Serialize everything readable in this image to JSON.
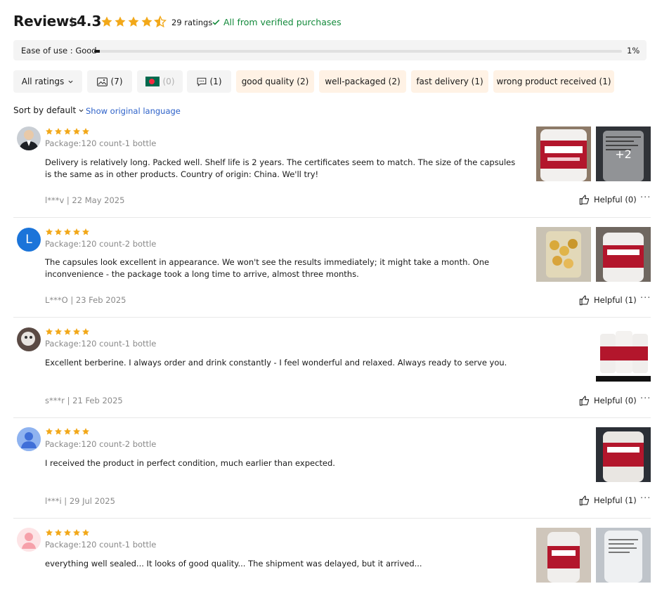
{
  "header": {
    "title": "Reviews",
    "separator": "|",
    "score": "4.3",
    "rating": 4.3,
    "ratings_count": "29 ratings",
    "verified": "All from verified purchases"
  },
  "ease": {
    "label": "Ease of use : Good",
    "percent": "1%",
    "fraction": 0.01
  },
  "filters": {
    "all_ratings": "All ratings",
    "photos": "(7)",
    "country": "(0)",
    "comments": "(1)",
    "tags": [
      "good quality (2)",
      "well-packaged (2)",
      "fast delivery (1)",
      "wrong product received (1)"
    ]
  },
  "sort": {
    "label": "Sort by default",
    "original_language": "Show original language"
  },
  "reviews": [
    {
      "package": "Package:120 count-1 bottle",
      "text": "Delivery is relatively long. Packed well. Shelf life is 2 years. The certificates seem to match. The size of the capsules is the same as in other products. Country of origin: China. We'll try!",
      "meta": "l***v | 22 May 2025",
      "helpful": "Helpful (0)",
      "more_photos": "+2",
      "stars": 5
    },
    {
      "package": "Package:120 count-2 bottle",
      "text": "The capsules look excellent in appearance. We won't see the results immediately; it might take a month. One inconvenience - the package took a long time to arrive, almost three months.",
      "meta": "L***O | 23 Feb 2025",
      "helpful": "Helpful (1)",
      "avatar_letter": "L",
      "stars": 5
    },
    {
      "package": "Package:120 count-1 bottle",
      "text": "Excellent berberine. I always order and drink constantly - I feel wonderful and relaxed. Always ready to serve you.",
      "meta": "s***r | 21 Feb 2025",
      "helpful": "Helpful (0)",
      "stars": 5
    },
    {
      "package": "Package:120 count-2 bottle",
      "text": "I received the product in perfect condition, much earlier than expected.",
      "meta": "l***i | 29 Jul 2025",
      "helpful": "Helpful (1)",
      "stars": 5
    },
    {
      "package": "Package:120 count-1 bottle",
      "text": "everything well sealed... It looks of good quality... The shipment was delayed, but it arrived...",
      "stars": 5
    }
  ],
  "colors": {
    "star": "#f2a819",
    "verified": "#138a3b",
    "link": "#2e62c9",
    "chip_grey": "#f4f4f4",
    "chip_peach": "#fff2e5"
  },
  "icons": [
    "star-icon",
    "half-star-icon",
    "check-icon",
    "image-icon",
    "flag-icon",
    "comment-icon",
    "chevron-down-icon",
    "thumbs-up-icon",
    "more-icon"
  ]
}
